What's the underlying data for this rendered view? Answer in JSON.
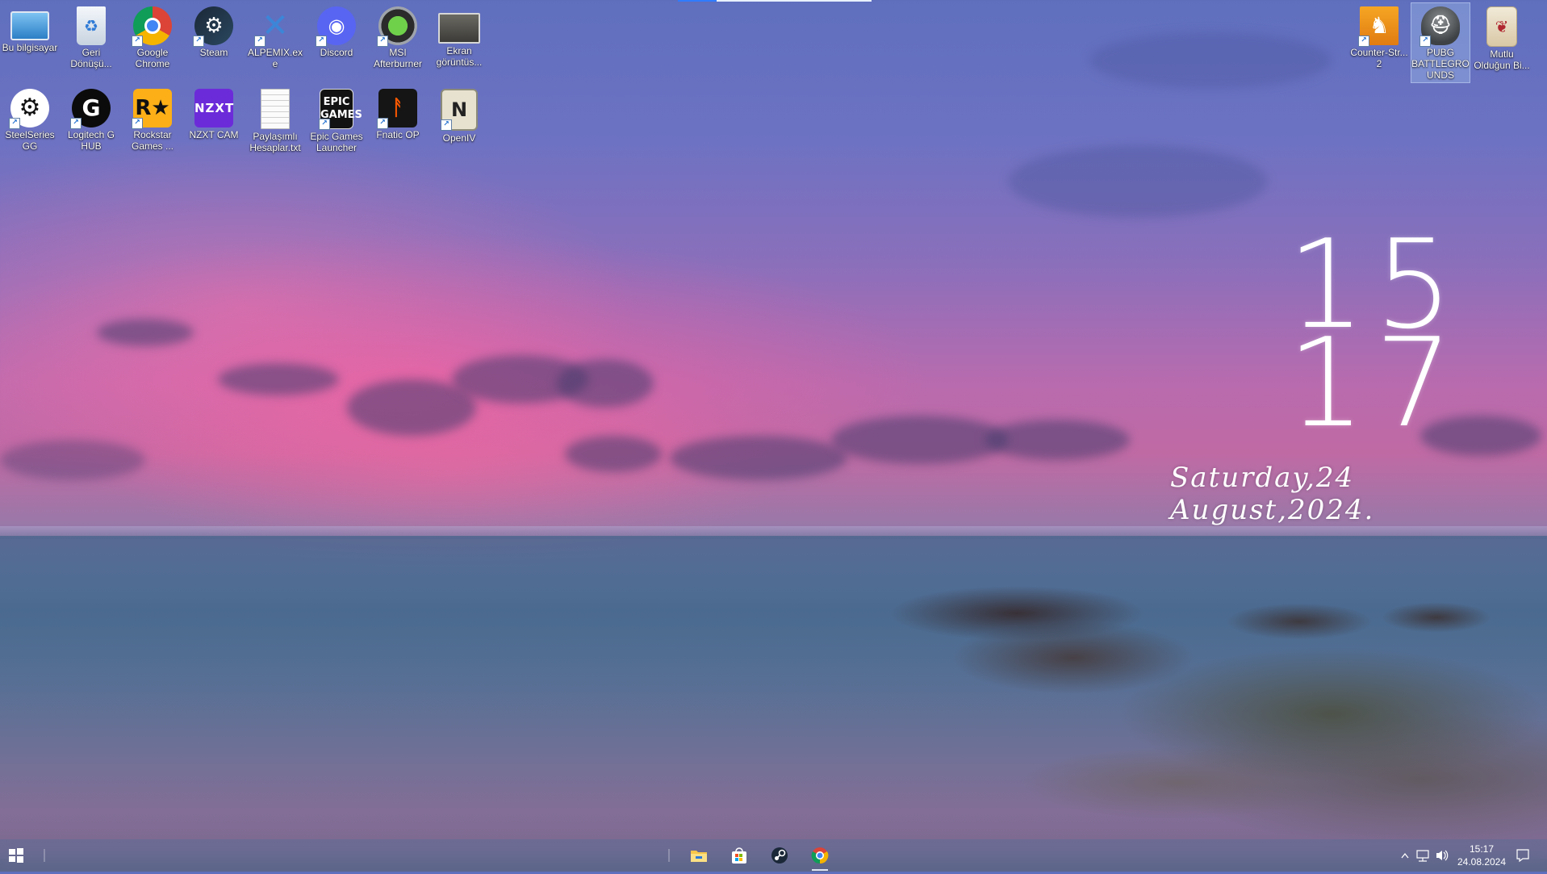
{
  "desktop": {
    "icons": [
      {
        "label": "Bu bilgisayar",
        "icon": "computer-icon"
      },
      {
        "label": "Geri Dönüşü...",
        "icon": "recycle-bin-icon"
      },
      {
        "label": "Google Chrome",
        "icon": "chrome-icon"
      },
      {
        "label": "Steam",
        "icon": "steam-icon"
      },
      {
        "label": "ALPEMIX.exe",
        "icon": "alpemix-icon"
      },
      {
        "label": "Discord",
        "icon": "discord-icon"
      },
      {
        "label": "MSI Afterburner",
        "icon": "msi-afterburner-icon"
      },
      {
        "label": "Ekran görüntüs...",
        "icon": "screenshot-icon"
      },
      {
        "label": "SteelSeries GG",
        "icon": "steelseries-icon"
      },
      {
        "label": "Logitech G HUB",
        "icon": "logitech-icon"
      },
      {
        "label": "Rockstar Games ...",
        "icon": "rockstar-icon"
      },
      {
        "label": "NZXT CAM",
        "icon": "nzxt-icon"
      },
      {
        "label": "Paylaşımlı Hesaplar.txt",
        "icon": "text-file-icon"
      },
      {
        "label": "Epic Games Launcher",
        "icon": "epic-games-icon"
      },
      {
        "label": "Fnatic OP",
        "icon": "fnatic-icon"
      },
      {
        "label": "OpenIV",
        "icon": "openiv-icon"
      },
      {
        "label": "Counter-Str... 2",
        "icon": "counter-strike-icon"
      },
      {
        "label": "PUBG BATTLEGROUNDS",
        "icon": "pubg-icon"
      },
      {
        "label": "Mutlu Olduğun Bi...",
        "icon": "image-file-icon"
      }
    ],
    "selected_icon": "PUBG BATTLEGROUNDS"
  },
  "clock_widget": {
    "hour": "15",
    "minute": "17",
    "date": "Saturday,24 August,2024."
  },
  "taskbar": {
    "start_icon": "windows-start-icon",
    "pinned": [
      {
        "name": "File Explorer",
        "icon": "file-explorer-icon",
        "running": false
      },
      {
        "name": "Microsoft Store",
        "icon": "store-icon",
        "running": false
      },
      {
        "name": "Steam",
        "icon": "steam-icon",
        "running": false
      },
      {
        "name": "Google Chrome",
        "icon": "chrome-icon",
        "running": true
      }
    ],
    "tray": {
      "icons": [
        "chevron-up-icon",
        "network-icon",
        "volume-icon"
      ],
      "time": "15:17",
      "date": "24.08.2024",
      "notification_icon": "notification-icon"
    }
  },
  "colors": {
    "accent": "#2f7bff",
    "taskbar": "#5c6c96"
  }
}
